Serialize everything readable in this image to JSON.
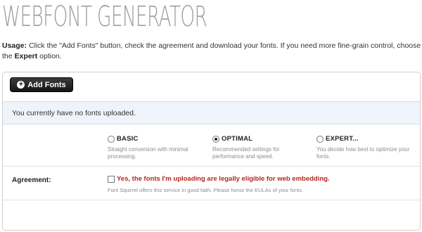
{
  "page": {
    "title": "WEBFONT GENERATOR"
  },
  "usage": {
    "label": "Usage:",
    "text_part1": "Click the \"Add Fonts\" button, check the agreement and download your fonts. If you need more fine-grain control, choose the",
    "expert_word": "Expert",
    "text_part2": "option."
  },
  "toolbar": {
    "add_fonts_label": "Add Fonts",
    "add_icon": "plus-circle-icon"
  },
  "notice": {
    "text": "You currently have no fonts uploaded."
  },
  "modes": {
    "selected": "OPTIMAL",
    "options": [
      {
        "label": "BASIC",
        "description": "Straight conversion with minimal processing.",
        "checked": false
      },
      {
        "label": "OPTIMAL",
        "description": "Recommended settings for performance and speed.",
        "checked": true
      },
      {
        "label": "EXPERT...",
        "description": "You decide how best to optimize your fonts.",
        "checked": false
      }
    ]
  },
  "agreement": {
    "label": "Agreement:",
    "checked": false,
    "checkbox_text": "Yes, the fonts I'm uploading are legally eligible for web embedding.",
    "note": "Font Squirrel offers this service in good faith. Please honor the EULAs of your fonts."
  },
  "colors": {
    "title": "#9d9d9d",
    "notice_bg": "#eef4fa",
    "agreement_text": "#b3261e",
    "button_bg": "#1a1a1a"
  }
}
